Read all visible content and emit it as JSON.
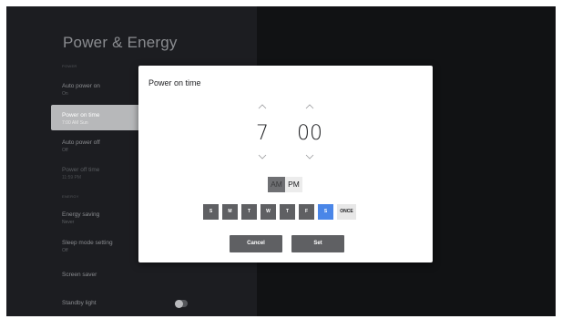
{
  "panel": {
    "title": "Power & Energy",
    "sections": {
      "power": "POWER",
      "energy": "ENERGY"
    },
    "items": [
      {
        "label": "Auto power on",
        "value": "On"
      },
      {
        "label": "Power on time",
        "value": "7:00 AM Sun"
      },
      {
        "label": "Auto power off",
        "value": "Off"
      },
      {
        "label": "Power off time",
        "value": "11:59 PM"
      },
      {
        "label": "Energy saving",
        "value": "Never"
      },
      {
        "label": "Sleep mode setting",
        "value": "Off"
      },
      {
        "label": "Screen saver",
        "value": ""
      },
      {
        "label": "Standby light",
        "value": ""
      }
    ],
    "standby_light_on": false
  },
  "dialog": {
    "title": "Power on time",
    "hour": "7",
    "minute": "00",
    "ampm": {
      "am": "AM",
      "pm": "PM",
      "selected": "AM"
    },
    "days": [
      "S",
      "M",
      "T",
      "W",
      "T",
      "F",
      "S"
    ],
    "active_day_index": 6,
    "once_label": "ONCE",
    "cancel_label": "Cancel",
    "set_label": "Set"
  },
  "colors": {
    "screen_bg": "#111214",
    "panel_bg": "#1c1d21",
    "selected_item_bg": "#b7b8ba",
    "day_button": "#5f6063",
    "day_button_active": "#4a86e8",
    "dialog_bg": "#ffffff"
  }
}
